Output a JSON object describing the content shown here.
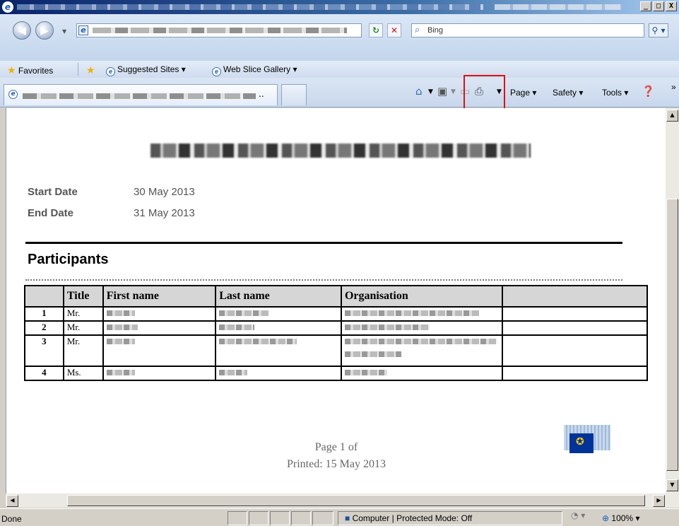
{
  "window": {
    "controls": {
      "minimize": "_",
      "maximize": "□",
      "close": "X"
    }
  },
  "address_bar": {
    "search_placeholder": "Bing"
  },
  "favorites_bar": {
    "favorites_label": "Favorites",
    "items": [
      {
        "label": "Suggested Sites ▾",
        "icon": "ie-icon"
      },
      {
        "label": "Web Slice Gallery ▾",
        "icon": "ie-icon"
      }
    ]
  },
  "command_bar": {
    "page_label": "Page ▾",
    "safety_label": "Safety ▾",
    "tools_label": "Tools ▾",
    "overflow": "»"
  },
  "document": {
    "start_date_label": "Start Date",
    "start_date_value": "30 May 2013",
    "end_date_label": "End Date",
    "end_date_value": "31 May 2013",
    "section_title": "Participants",
    "table": {
      "headers": [
        "",
        "Title",
        "First name",
        "Last name",
        "Organisation",
        ""
      ],
      "rows": [
        {
          "num": "1",
          "title": "Mr."
        },
        {
          "num": "2",
          "title": "Mr."
        },
        {
          "num": "3",
          "title": "Mr."
        },
        {
          "num": "4",
          "title": "Ms."
        }
      ]
    },
    "footer_page": "Page 1  of",
    "footer_printed": "Printed: 15 May 2013"
  },
  "status_bar": {
    "status": "Done",
    "zone": "Computer | Protected Mode: Off",
    "zoom": "100%"
  },
  "highlight_color": "#e01010"
}
